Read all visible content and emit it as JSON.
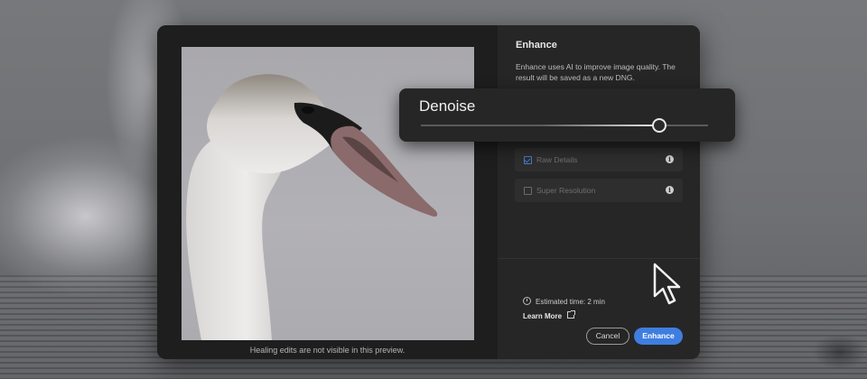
{
  "preview": {
    "caption": "Healing edits are not visible in this preview."
  },
  "enhance": {
    "title": "Enhance",
    "description": "Enhance uses AI to improve image quality. The result will be saved as a new DNG.",
    "options": [
      {
        "label": "Raw Details",
        "checked": true
      },
      {
        "label": "Super Resolution",
        "checked": false
      }
    ],
    "estimated_time": "Estimated time: 2 min",
    "learn_more": "Learn More",
    "cancel_label": "Cancel",
    "enhance_label": "Enhance",
    "info_glyph": "i"
  },
  "denoise": {
    "label": "Denoise",
    "value_fraction": 0.83
  },
  "colors": {
    "accent": "#3f7ee0",
    "panel": "#262626"
  },
  "icons": [
    "info-icon",
    "clock-icon",
    "external-link-icon",
    "checkbox-icon",
    "cursor-icon"
  ]
}
